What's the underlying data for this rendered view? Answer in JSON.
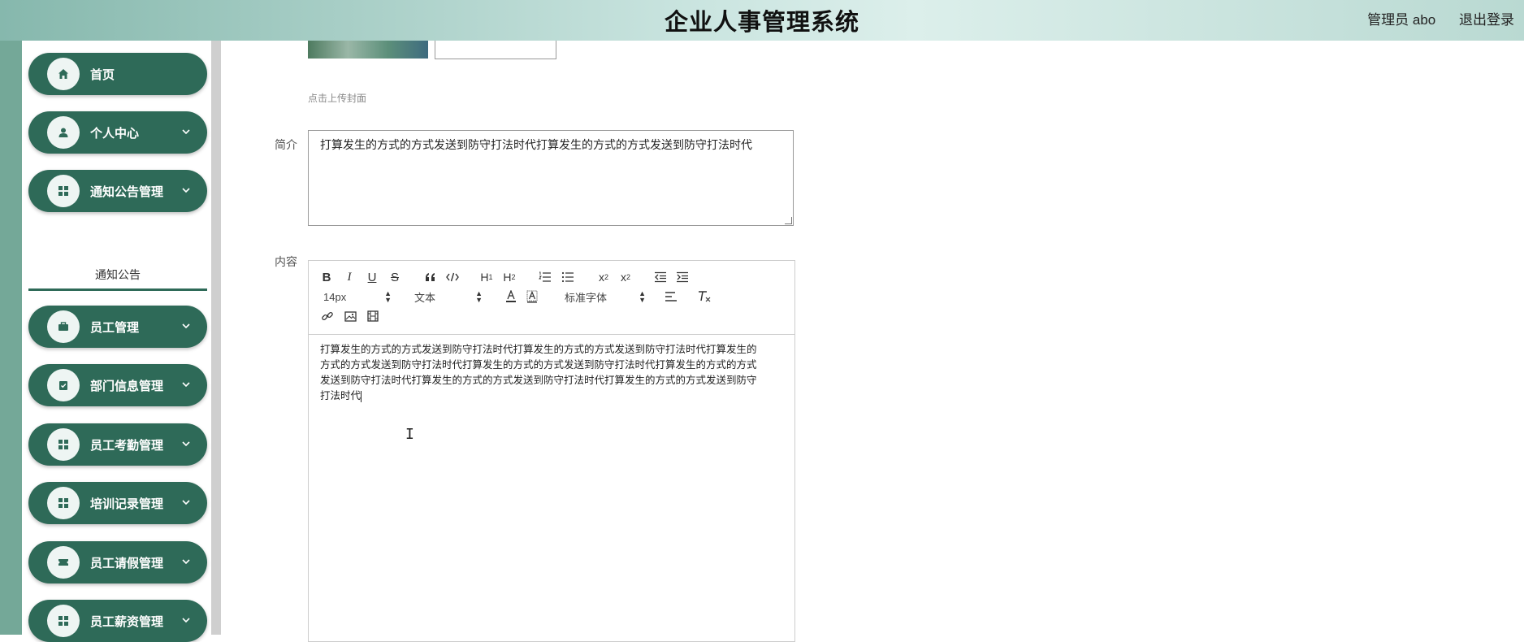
{
  "header": {
    "app_title": "企业人事管理系统",
    "user_label": "管理员 abo",
    "logout_label": "退出登录"
  },
  "sidebar": {
    "items": [
      {
        "label": "首页",
        "icon": "home-icon"
      },
      {
        "label": "个人中心",
        "icon": "person-icon"
      },
      {
        "label": "通知公告管理",
        "icon": "grid-icon"
      },
      {
        "label": "员工管理",
        "icon": "briefcase-icon"
      },
      {
        "label": "部门信息管理",
        "icon": "clipboard-icon"
      },
      {
        "label": "员工考勤管理",
        "icon": "grid-icon"
      },
      {
        "label": "培训记录管理",
        "icon": "grid-icon"
      },
      {
        "label": "员工请假管理",
        "icon": "ticket-icon"
      },
      {
        "label": "员工薪资管理",
        "icon": "grid-icon"
      }
    ],
    "sub_item": {
      "label": "通知公告"
    }
  },
  "form": {
    "upload_hint": "点击上传封面",
    "summary_label": "简介",
    "summary_value": "打算发生的方式的方式发送到防守打法时代打算发生的方式的方式发送到防守打法时代",
    "content_label": "内容"
  },
  "editor": {
    "font_size": "14px",
    "paragraph_type": "文本",
    "font_family": "标准字体",
    "content_lines": [
      "打算发生的方式的方式发送到防守打法时代打算发生的方式的方式发送到防守打法时代打算发生的",
      "方式的方式发送到防守打法时代打算发生的方式的方式发送到防守打法时代打算发生的方式的方式",
      "发送到防守打法时代打算发生的方式的方式发送到防守打法时代打算发生的方式的方式发送到防守",
      "打法时代"
    ],
    "buttons": [
      "bold",
      "italic",
      "underline",
      "strike",
      "blockquote",
      "code-block",
      "h1",
      "h2",
      "ordered-list",
      "bullet-list",
      "subscript",
      "superscript",
      "outdent",
      "indent",
      "text-color",
      "background-color",
      "align",
      "clean",
      "link",
      "image",
      "video"
    ]
  },
  "colors": {
    "sidebar_item_bg": "#2e6a58",
    "header_gradient_start": "#86b8ad",
    "header_gradient_end": "#dcefeb"
  }
}
